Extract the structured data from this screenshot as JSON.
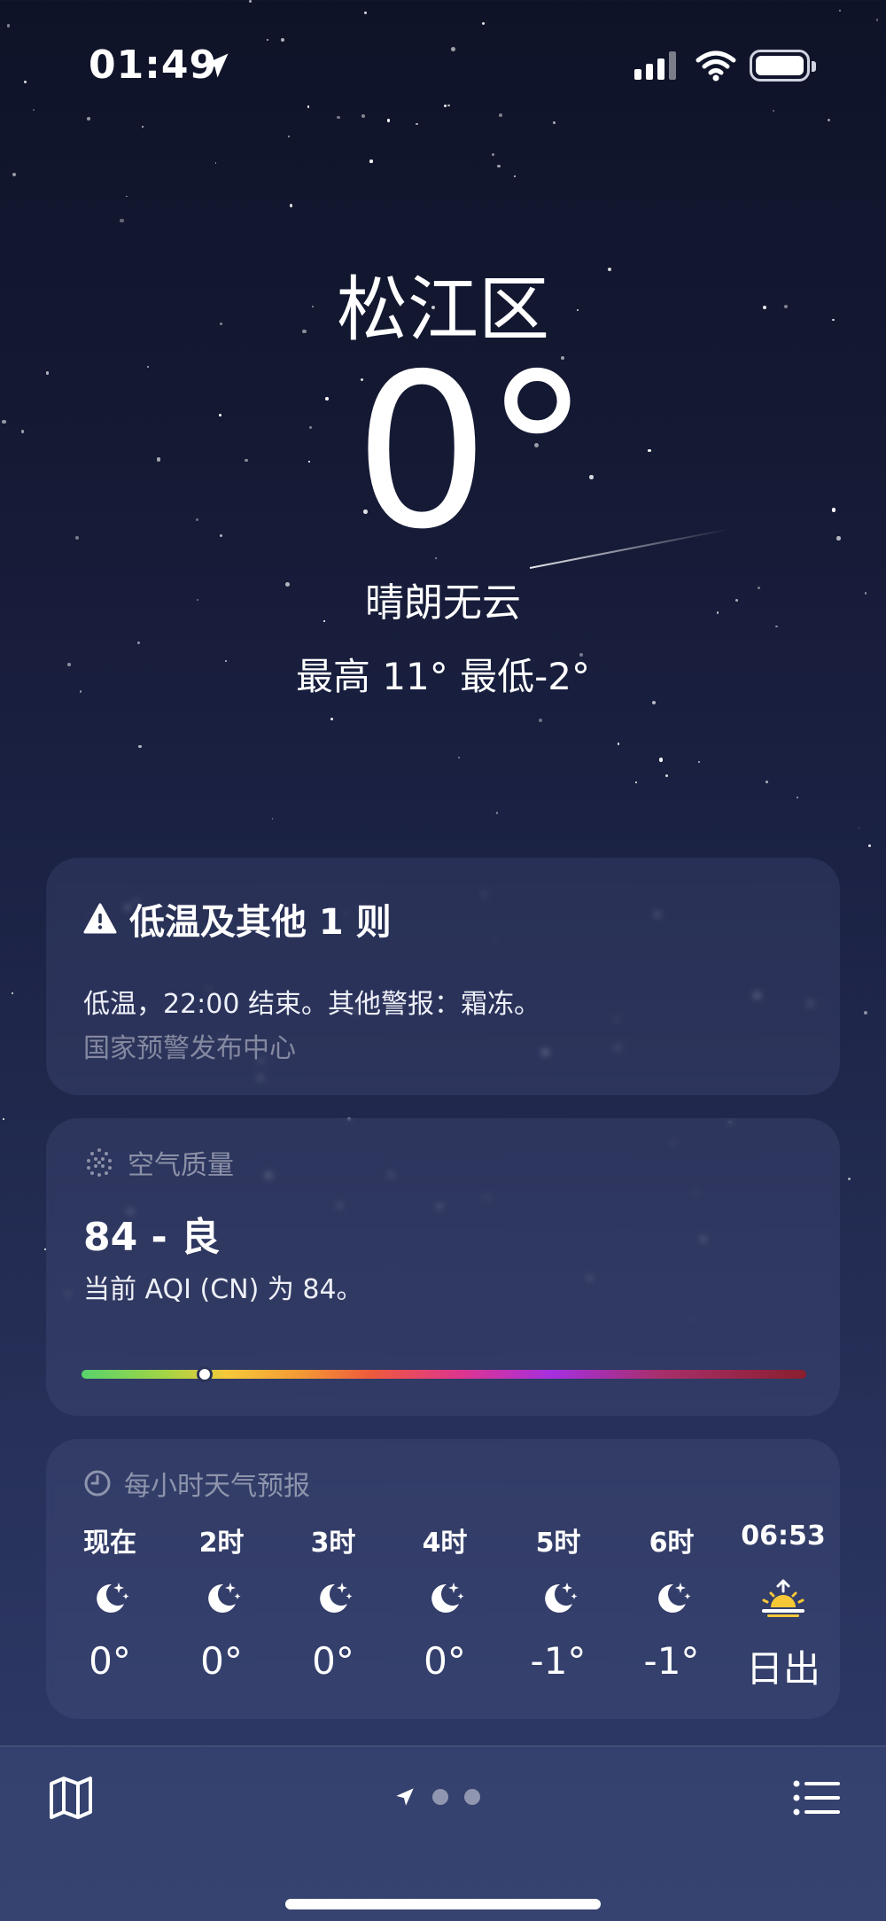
{
  "status_bar": {
    "time": "01:49"
  },
  "hero": {
    "city": "松江区",
    "temperature": "0",
    "degree": "°",
    "condition": "晴朗无云",
    "hi_lo": "最高 11° 最低-2°"
  },
  "alert": {
    "title": "低温及其他 1 则",
    "text": "低温，22:00 结束。其他警报：霜冻。",
    "source": "国家预警发布中心",
    "icon": "warning-triangle-icon"
  },
  "air_quality": {
    "header": "空气质量",
    "value": "84 - 良",
    "description": "当前 AQI (CN) 为 84。",
    "aqi": 84,
    "bar_position_fraction": 0.17
  },
  "hourly": {
    "header": "每小时天气预报",
    "hours": [
      {
        "label": "现在",
        "icon": "moon-stars-icon",
        "temp": "0°"
      },
      {
        "label": "2时",
        "icon": "moon-stars-icon",
        "temp": "0°"
      },
      {
        "label": "3时",
        "icon": "moon-stars-icon",
        "temp": "0°"
      },
      {
        "label": "4时",
        "icon": "moon-stars-icon",
        "temp": "0°"
      },
      {
        "label": "5时",
        "icon": "moon-stars-icon",
        "temp": "-1°"
      },
      {
        "label": "6时",
        "icon": "moon-stars-icon",
        "temp": "-1°"
      },
      {
        "label": "06:53",
        "icon": "sunrise-icon",
        "temp": "日出"
      }
    ]
  },
  "colors": {
    "sunrise": "#f6c836",
    "aqi_good": "#58d36c"
  }
}
